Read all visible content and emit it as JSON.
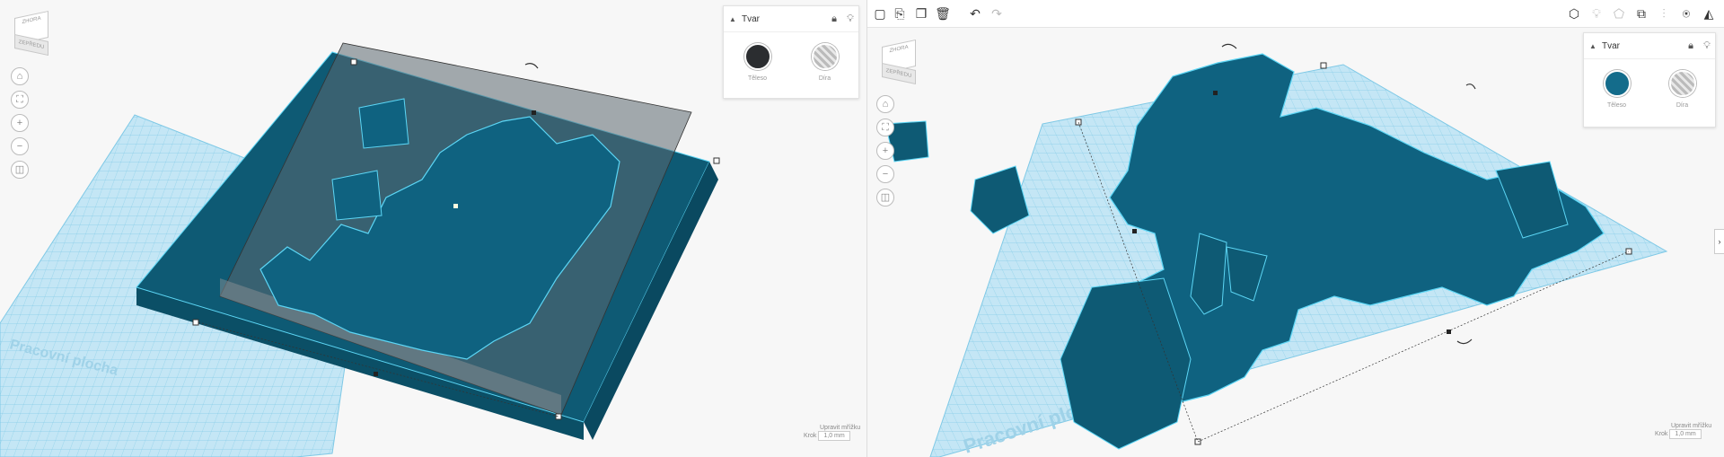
{
  "left": {
    "viewcube": {
      "top": "ZHORA",
      "front": "ZEPŘEDU"
    },
    "inspector": {
      "title": "Tvar",
      "solid_label": "Těleso",
      "hole_label": "Díra",
      "solid_color": "#2b2d30"
    },
    "workplane_label": "Pracovní plocha",
    "snap": {
      "label_top": "Upravit mřížku",
      "label_left": "Krok",
      "value": "1,0 mm"
    }
  },
  "right": {
    "viewcube": {
      "top": "ZHORA",
      "front": "ZEPŘEDU"
    },
    "inspector": {
      "title": "Tvar",
      "solid_label": "Těleso",
      "hole_label": "Díra",
      "solid_color": "#146c8b"
    },
    "workplane_label": "Pracovní plocha",
    "snap": {
      "label_top": "Upravit mřížku",
      "label_left": "Krok",
      "value": "1,0 mm"
    }
  },
  "colors": {
    "model": "#0e5a74",
    "model_edge": "#5cd6f5",
    "grid": "#bfe5f4",
    "grid_line": "#7fc9e6"
  }
}
